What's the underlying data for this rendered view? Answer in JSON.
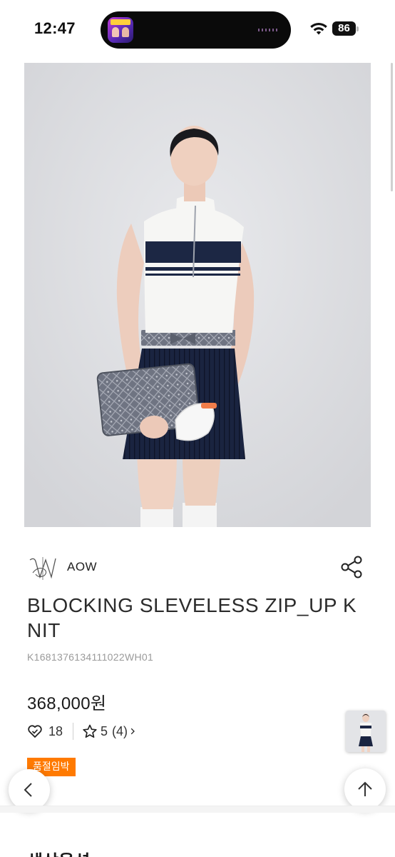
{
  "status_bar": {
    "time": "12:47",
    "battery": "86",
    "icons": [
      "island-app-icon",
      "wifi-icon",
      "battery-icon"
    ]
  },
  "product": {
    "image_icon": "product-photo",
    "brand": {
      "logo_icon": "brand-logo-icon",
      "name": "AOW"
    },
    "title": "BLOCKING SLEVELESS ZIP_UP KNIT",
    "code": "K1681376134111022WH01",
    "price": "368,000원",
    "likes": "18",
    "rating": {
      "score": "5",
      "count": "(4)"
    },
    "badge": "품절임박"
  },
  "actions": {
    "share_icon": "share-icon",
    "back_icon": "chevron-left-icon",
    "top_icon": "arrow-up-icon"
  },
  "section": {
    "heading": "색상옵션"
  },
  "colors": {
    "badge_bg": "#ff7a00",
    "navy": "#1c2744",
    "image_bg": "#dcdde0"
  }
}
